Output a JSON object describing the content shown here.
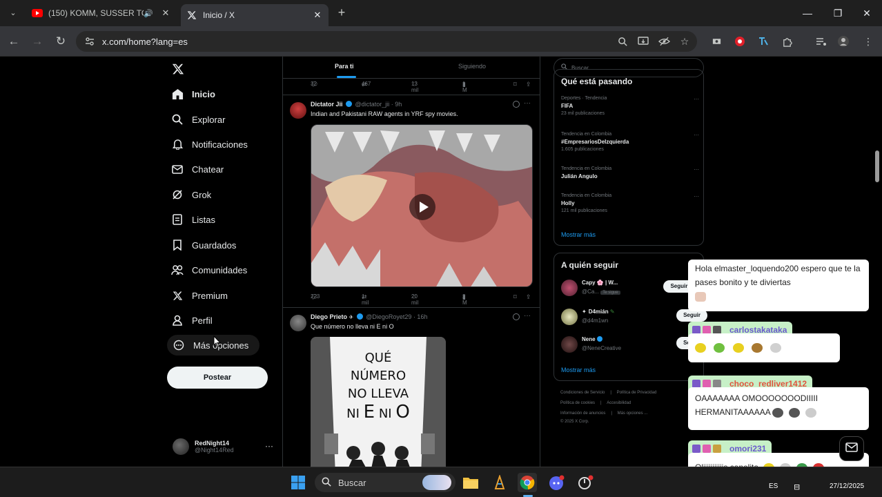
{
  "browser": {
    "tabs": [
      {
        "title": "(150) KOMM, SUSSER TOD | ",
        "favicon": "youtube-icon",
        "audio": true
      },
      {
        "title": "Inicio / X",
        "favicon": "x-icon",
        "active": true
      }
    ],
    "url": "x.com/home?lang=es"
  },
  "nav": {
    "items": [
      {
        "label": "Inicio",
        "icon": "home-icon"
      },
      {
        "label": "Explorar",
        "icon": "search-icon"
      },
      {
        "label": "Notificaciones",
        "icon": "bell-icon"
      },
      {
        "label": "Chatear",
        "icon": "mail-icon"
      },
      {
        "label": "Grok",
        "icon": "grok-icon"
      },
      {
        "label": "Listas",
        "icon": "list-icon"
      },
      {
        "label": "Guardados",
        "icon": "bookmark-icon"
      },
      {
        "label": "Comunidades",
        "icon": "people-icon"
      },
      {
        "label": "Premium",
        "icon": "x-icon"
      },
      {
        "label": "Perfil",
        "icon": "person-icon"
      },
      {
        "label": "Más opciones",
        "icon": "more-circle-icon"
      }
    ],
    "post_label": "Postear",
    "account": {
      "name": "RedNight14",
      "handle": "@Night14Red"
    }
  },
  "feed": {
    "tabs": [
      "Para ti",
      "Siguiendo"
    ],
    "top_actions": {
      "replies": "32",
      "reposts": "467",
      "likes": "13 mil",
      "views": "1 M"
    },
    "tweets": [
      {
        "name": "Dictator Jii",
        "handle": "@dictator_jii · 9h",
        "text": "Indian and Pakistani RAW agents in YRF spy movies.",
        "actions": {
          "replies": "223",
          "reposts": "1 mil",
          "likes": "20 mil",
          "views": "2 M"
        }
      },
      {
        "name": "Diego Prieto",
        "handle": "@DiegoRoyet29 · 16h",
        "text": "Que número no lleva ni E ni O",
        "image_lines": [
          "QUÉ",
          "NÚMERO",
          "NO LLEVA",
          "NI",
          "E",
          "NI",
          "O"
        ]
      }
    ]
  },
  "right": {
    "search_placeholder": "Buscar",
    "trends_title": "Qué está pasando",
    "trends": [
      {
        "context": "Deportes · Tendencia",
        "title": "FIFA",
        "count": "23 mil publicaciones"
      },
      {
        "context": "Tendencia en Colombia",
        "title": "#EmpresariosDeIzquierda",
        "count": "1.605 publicaciones"
      },
      {
        "context": "Tendencia en Colombia",
        "title": "Julián Angulo",
        "count": ""
      },
      {
        "context": "Tendencia en Colombia",
        "title": "Holly",
        "count": "121 mil publicaciones"
      }
    ],
    "show_more": "Mostrar más",
    "who_title": "A quién seguir",
    "who": [
      {
        "name": "Capy 🌸 | W...",
        "handle": "@Ca...",
        "tag": "Te sigue",
        "button": "Seguir tú también"
      },
      {
        "name": "D4mián",
        "handle": "@d4m1wn",
        "button": "Seguir"
      },
      {
        "name": "Nene",
        "handle": "@NeneCreative",
        "button": "Seguir"
      }
    ],
    "who_more": "Mostrar más",
    "footer": [
      [
        "Condiciones de Servicio",
        "Política de Privacidad"
      ],
      [
        "Política de cookies",
        "Accesibilidad"
      ],
      [
        "Información de anuncios",
        "Más opciones ..."
      ],
      [
        "© 2025 X Corp."
      ]
    ]
  },
  "chat": [
    {
      "user": "",
      "text": "Hola elmaster_loquendo200 espero que te la pases bonito y te diviertas"
    },
    {
      "user": "carlostakataka",
      "user_color": "#6a5acd",
      "text": ""
    },
    {
      "user": "choco_redliver1412",
      "user_color": "#e0533d",
      "text": "OAAAAAAA OMOOOOOOODIIIII HERMANITAAAAAA"
    },
    {
      "user": "omori231",
      "user_color": "#6a5acd",
      "text": "Oliiiiiiiiiiis canelita"
    }
  ],
  "taskbar": {
    "search_label": "Buscar",
    "lang": "ES",
    "date": "27/12/2025"
  },
  "colors": {
    "accent": "#1d9bf0",
    "bg": "#000000",
    "border": "#2f3336"
  }
}
